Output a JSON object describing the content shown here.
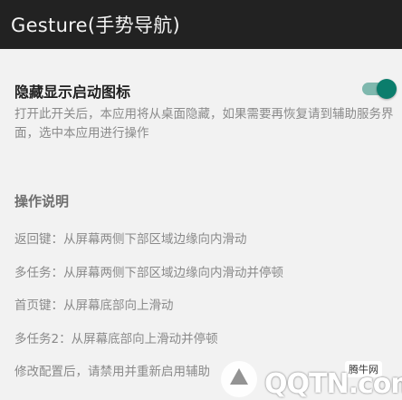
{
  "appbar": {
    "title": "Gesture(手势导航)"
  },
  "setting": {
    "title": "隐藏显示启动图标",
    "description": "打开此开关后，本应用将从桌面隐藏，如果需要再恢复请到辅助服务界面，选中本应用进行操作",
    "toggle_on": true
  },
  "instructions": {
    "header": "操作说明",
    "items": [
      "返回键：从屏幕两侧下部区域边缘向内滑动",
      "多任务：从屏幕两侧下部区域边缘向内滑动并停顿",
      "首页键：从屏幕底部向上滑动",
      "多任务2：从屏幕底部向上滑动并停顿",
      "修改配置后，请禁用并重新启用辅助"
    ]
  },
  "watermark": {
    "badge": "腾牛网",
    "text": "QQTN.com"
  },
  "colors": {
    "appbar_bg": "#222222",
    "page_bg": "#f2f2f2",
    "accent": "#0b7d6c",
    "track": "#7fb8ae"
  }
}
